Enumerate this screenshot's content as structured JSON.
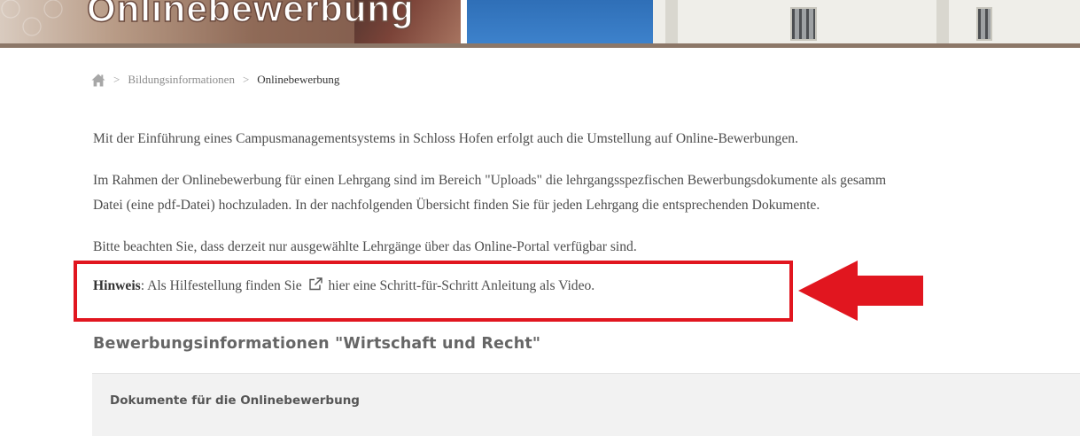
{
  "header": {
    "title": "Onlinebewerbung"
  },
  "breadcrumb": {
    "home_icon": "home-icon",
    "separator": ">",
    "items": [
      {
        "label": "Bildungsinformationen"
      },
      {
        "label": "Onlinebewerbung"
      }
    ]
  },
  "content": {
    "paragraph_1": "Mit der Einführung eines Campusmanagementsystems in Schloss Hofen erfolgt auch die Umstellung auf Online-Bewerbungen.",
    "paragraph_2_line_1": "Im Rahmen der Onlinebewerbung für einen Lehrgang sind im Bereich \"Uploads\" die lehrgangsspezfischen Bewerbungsdokumente als gesamm",
    "paragraph_2_line_2": "Datei (eine pdf-Datei) hochzuladen. In der nachfolgenden Übersicht finden Sie für jeden Lehrgang die entsprechenden Dokumente.",
    "paragraph_3": "Bitte beachten Sie, dass derzeit nur ausgewählte Lehrgänge über das Online-Portal verfügbar sind.",
    "hint": {
      "label": "Hinweis",
      "text_before": ": Als Hilfestellung finden Sie",
      "link_icon": "external-link-icon",
      "link_text": "hier eine Schritt-für-Schritt Anleitung als Video."
    }
  },
  "section": {
    "title": "Bewerbungsinformationen \"Wirtschaft und Recht\"",
    "box_title": "Dokumente für die Onlinebewerbung"
  },
  "colors": {
    "highlight": "#e1161f",
    "banner_bar": "#8c7768"
  }
}
